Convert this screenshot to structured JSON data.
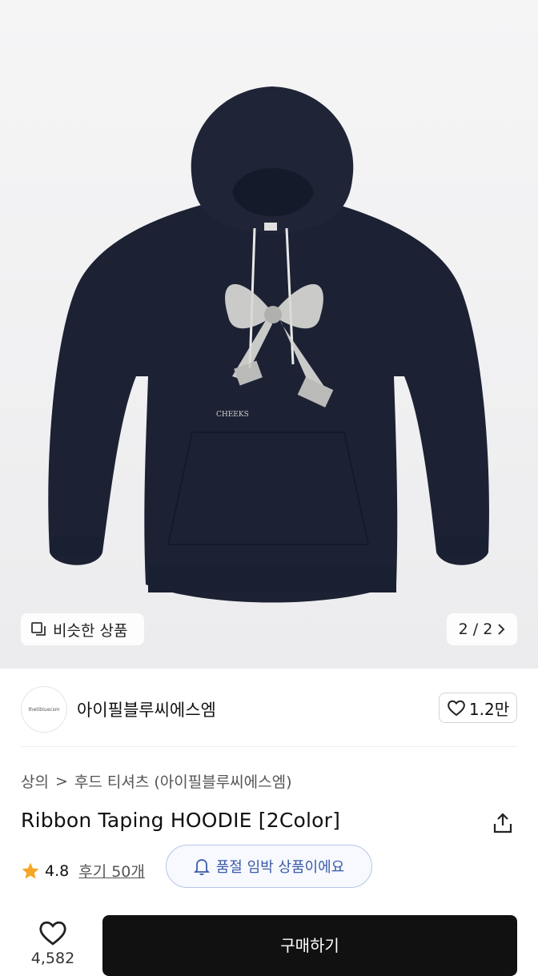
{
  "hero": {
    "similar_label": "비슷한 상품",
    "pager": "2 / 2",
    "print_text": "CHEEKS"
  },
  "brand": {
    "logo_text": "thetibluecsm",
    "name": "아이필블루씨에스엠",
    "likes": "1.2만"
  },
  "breadcrumb": {
    "level1": "상의",
    "separator": ">",
    "level2": "후드 티셔츠 (아이필블루씨에스엠)"
  },
  "product": {
    "title": "Ribbon Taping HOODIE [2Color]",
    "rating": "4.8",
    "review_label": "후기 50개",
    "soldout_notice": "품절 임박 상품이에요"
  },
  "bottom_bar": {
    "like_count": "4,582",
    "buy_label": "구매하기"
  },
  "colors": {
    "hoodie": "#1c2233",
    "star": "#f5a623",
    "notice_blue": "#3b5aa8"
  }
}
